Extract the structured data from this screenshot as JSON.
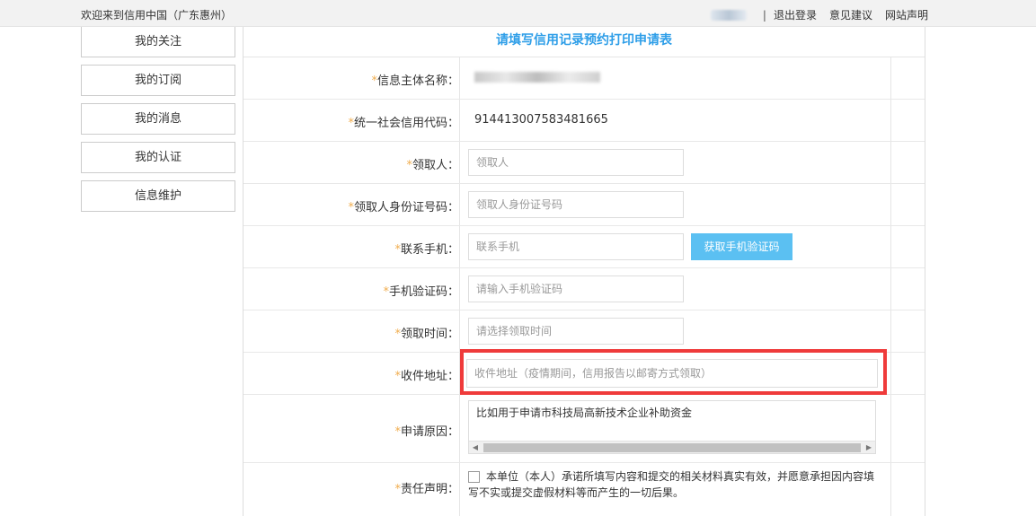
{
  "header": {
    "welcome": "欢迎来到信用中国（广东惠州）",
    "separator": "|",
    "logout": "退出登录",
    "feedback": "意见建议",
    "statement": "网站声明"
  },
  "sidebar": {
    "items": [
      {
        "label": "我的关注"
      },
      {
        "label": "我的订阅"
      },
      {
        "label": "我的消息"
      },
      {
        "label": "我的认证"
      },
      {
        "label": "信息维护"
      }
    ]
  },
  "form": {
    "title": "请填写信用记录预约打印申请表",
    "required_mark": "*",
    "entity_name_label": "信息主体名称：",
    "credit_code_label": "统一社会信用代码：",
    "credit_code_value": "914413007583481665",
    "recipient_label": "领取人：",
    "recipient_placeholder": "领取人",
    "recipient_id_label": "领取人身份证号码：",
    "recipient_id_placeholder": "领取人身份证号码",
    "phone_label": "联系手机：",
    "phone_placeholder": "联系手机",
    "get_code_button": "获取手机验证码",
    "code_label": "手机验证码：",
    "code_placeholder": "请输入手机验证码",
    "pickup_time_label": "领取时间：",
    "pickup_time_placeholder": "请选择领取时间",
    "address_label": "收件地址：",
    "address_placeholder": "收件地址（疫情期间，信用报告以邮寄方式领取）",
    "reason_label": "申请原因：",
    "reason_value": "比如用于申请市科技局高新技术企业补助资金",
    "declaration_label": "责任声明：",
    "declaration_text": "本单位（本人）承诺所填写内容和提交的相关材料真实有效，并愿意承担因内容填写不实或提交虚假材料等而产生的一切后果。"
  },
  "colors": {
    "title": "#2e9ee8",
    "required": "#f0ad4e",
    "button": "#5bc0f2",
    "highlight": "#ef3b3b"
  }
}
